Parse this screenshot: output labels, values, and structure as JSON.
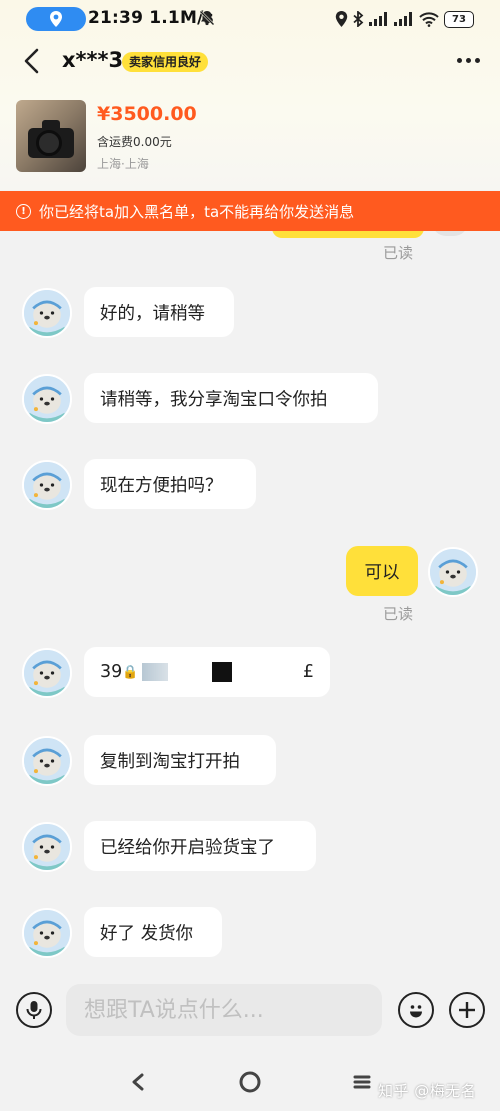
{
  "status_bar": {
    "time": "21:39",
    "network_speed": "1.1M/s",
    "battery": "73"
  },
  "header": {
    "seller_name": "x***3",
    "credit_badge": "卖家信用良好"
  },
  "product": {
    "price": "¥3500.00",
    "shipping": "含运费0.00元",
    "location": "上海·上海"
  },
  "warning": {
    "text": "你已经将ta加入黑名单，ta不能再给你发送消息"
  },
  "chat": {
    "read_label": "已读",
    "messages": [
      {
        "from": "seller",
        "text": "好的，请稍等"
      },
      {
        "from": "seller",
        "text": "请稍等，我分享淘宝口令你拍"
      },
      {
        "from": "seller",
        "text": "现在方便拍吗？"
      },
      {
        "from": "me",
        "text": "可以"
      },
      {
        "from": "seller",
        "code_prefix": "39",
        "code_suffix": "£"
      },
      {
        "from": "seller",
        "text": "复制到淘宝打开拍"
      },
      {
        "from": "seller",
        "text": "已经给你开启验货宝了"
      },
      {
        "from": "seller",
        "text": "好了 发货你"
      }
    ]
  },
  "input_bar": {
    "placeholder": "想跟TA说点什么..."
  },
  "watermark": "知乎 @梅无名",
  "colors": {
    "accent_yellow": "#ffe03a",
    "warning_orange": "#ff5a1f",
    "price_orange": "#ff5a1f",
    "background": "#f2f2f2"
  },
  "icons": {
    "location": "location-icon",
    "mute": "mute-icon",
    "back": "chevron-left-icon",
    "more": "more-icon",
    "voice": "microphone-icon",
    "emoji": "emoji-icon",
    "add": "plus-icon"
  }
}
